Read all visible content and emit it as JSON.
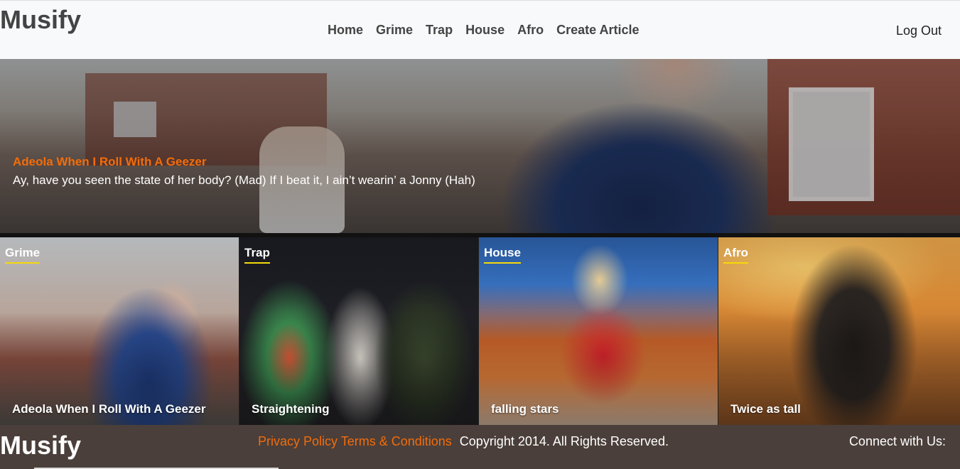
{
  "navbar": {
    "brand": "Musify",
    "links": [
      "Home",
      "Grime",
      "Trap",
      "House",
      "Afro",
      "Create Article"
    ],
    "logout": "Log Out"
  },
  "hero": {
    "title": "Adeola When I Roll With A Geezer",
    "text": "Ay, have you seen the state of her body? (Mad) If I beat it, I ain’t wearin’ a Jonny (Hah)"
  },
  "cards": [
    {
      "genre": "Grime",
      "title": "Adeola When I Roll With A Geezer"
    },
    {
      "genre": "Trap",
      "title": "Straightening"
    },
    {
      "genre": "House",
      "title": "falling stars"
    },
    {
      "genre": "Afro",
      "title": "Twice as tall"
    }
  ],
  "footer": {
    "brand": "Musify",
    "privacy": "Privacy Policy",
    "terms": "Terms & Conditions",
    "copyright": "Copyright 2014.  All Rights Reserved.",
    "connect": "Connect with Us:"
  },
  "colors": {
    "accent": "#f36c0a",
    "underline": "#f5d90a",
    "footer_bg": "#4a3f3a",
    "navbar_bg": "#f8f9fa"
  }
}
